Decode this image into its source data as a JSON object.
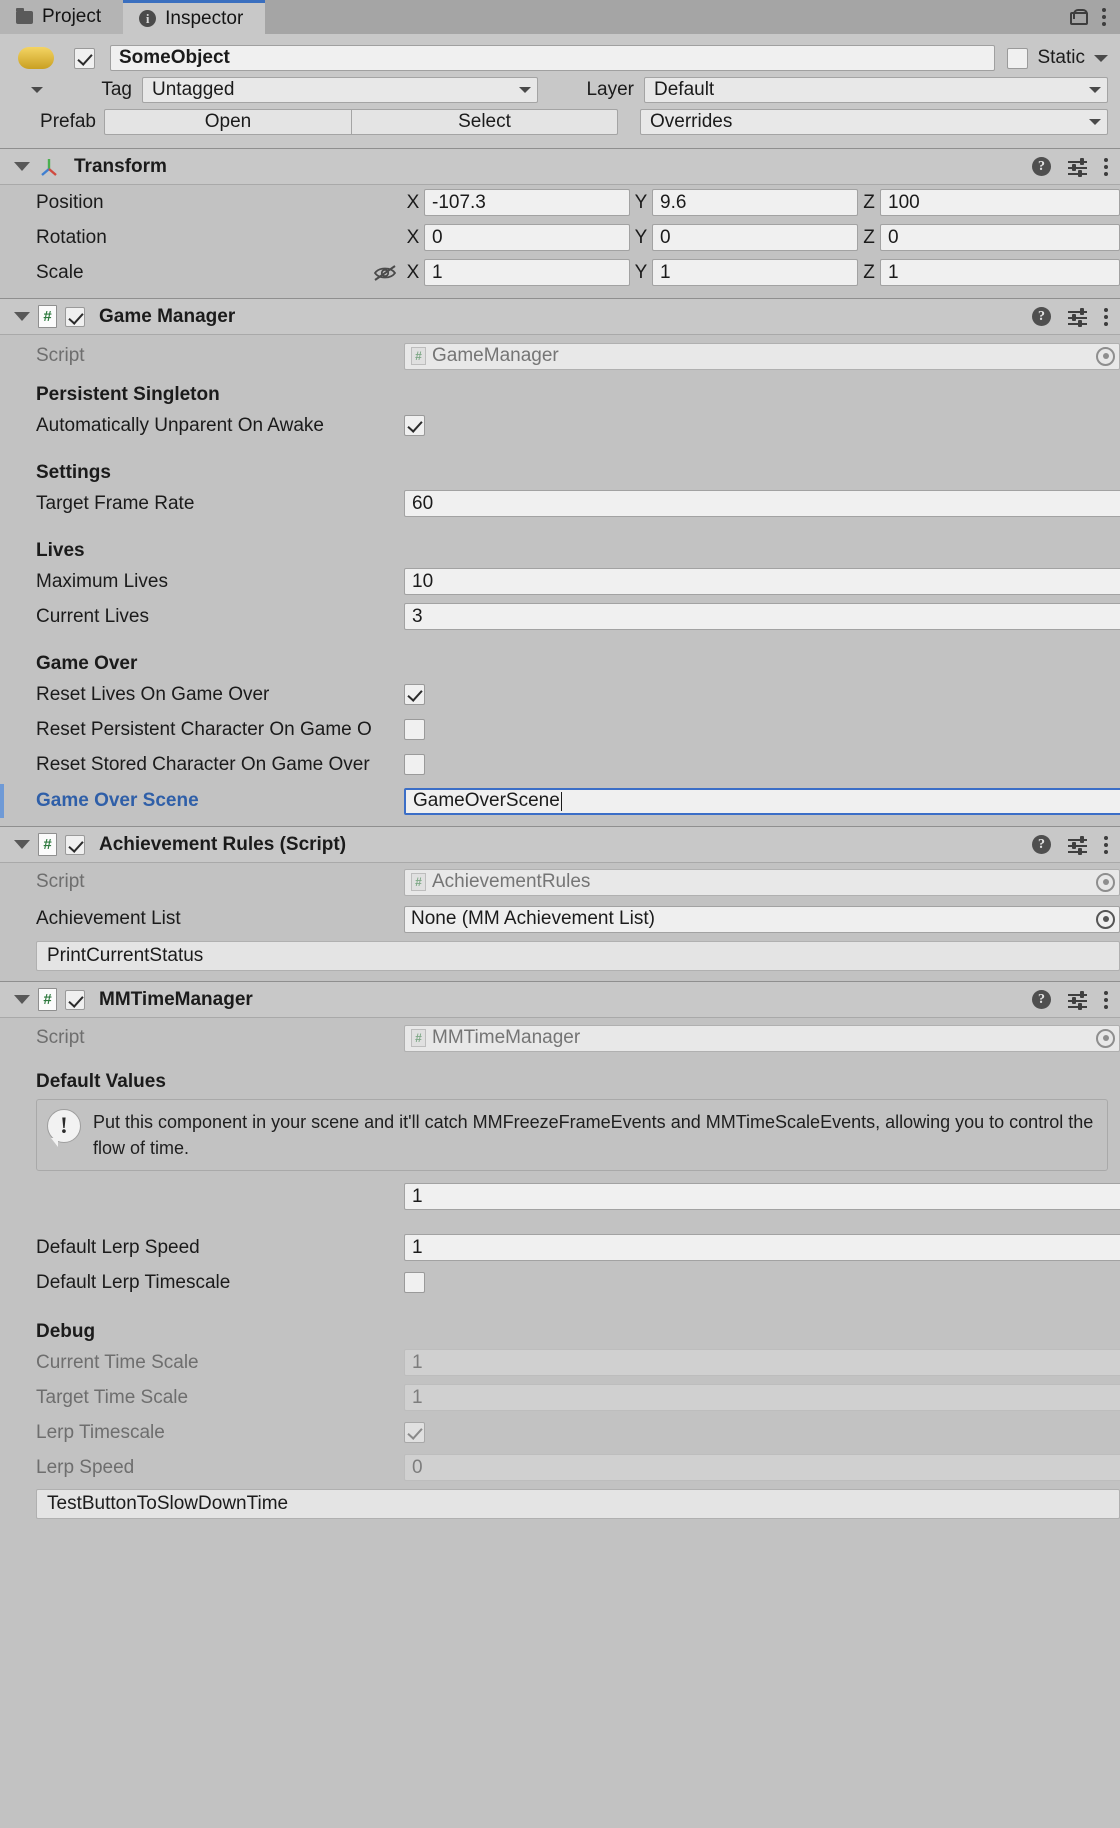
{
  "window": {
    "tabs": [
      {
        "label": "Project",
        "icon": "folder-icon",
        "active": false
      },
      {
        "label": "Inspector",
        "icon": "info-icon",
        "active": true
      }
    ],
    "lock_icon": "lock-icon",
    "menu_icon": "kebab-menu-icon"
  },
  "object_header": {
    "enabled": true,
    "name": "SomeObject",
    "static_label": "Static",
    "static_checked": false,
    "tag_label": "Tag",
    "tag_value": "Untagged",
    "layer_label": "Layer",
    "layer_value": "Default",
    "prefab_label": "Prefab",
    "open_label": "Open",
    "select_label": "Select",
    "overrides_label": "Overrides"
  },
  "transform": {
    "title": "Transform",
    "icon": "transform-axis-icon",
    "rows": [
      {
        "label": "Position",
        "x": "-107.3",
        "y": "9.6",
        "z": "100"
      },
      {
        "label": "Rotation",
        "x": "0",
        "y": "0",
        "z": "0"
      },
      {
        "label": "Scale",
        "x": "1",
        "y": "1",
        "z": "1",
        "constrain_icon": "eye-off-icon"
      }
    ],
    "axes": [
      "X",
      "Y",
      "Z"
    ]
  },
  "game_manager": {
    "title": "Game Manager",
    "enabled": true,
    "script_label": "Script",
    "script_value": "GameManager",
    "sections": [
      {
        "heading": "Persistent Singleton",
        "fields": [
          {
            "type": "checkbox",
            "label": "Automatically Unparent On Awake",
            "value": true
          }
        ]
      },
      {
        "heading": "Settings",
        "fields": [
          {
            "type": "text",
            "label": "Target Frame Rate",
            "value": "60"
          }
        ]
      },
      {
        "heading": "Lives",
        "fields": [
          {
            "type": "text",
            "label": "Maximum Lives",
            "value": "10"
          },
          {
            "type": "text",
            "label": "Current Lives",
            "value": "3"
          }
        ]
      },
      {
        "heading": "Game Over",
        "fields": [
          {
            "type": "checkbox",
            "label": "Reset Lives On Game Over",
            "value": true
          },
          {
            "type": "checkbox",
            "label": "Reset Persistent Character On Game O",
            "value": false
          },
          {
            "type": "checkbox",
            "label": "Reset Stored Character On Game Over",
            "value": false
          },
          {
            "type": "text-focused",
            "label": "Game Over Scene",
            "value": "GameOverScene",
            "highlight": true
          }
        ]
      }
    ]
  },
  "achievement_rules": {
    "title": "Achievement Rules (Script)",
    "enabled": true,
    "script_label": "Script",
    "script_value": "AchievementRules",
    "achievement_list_label": "Achievement List",
    "achievement_list_value": "None (MM Achievement List)",
    "button_label": "PrintCurrentStatus"
  },
  "mm_time_manager": {
    "title": "MMTimeManager",
    "enabled": true,
    "script_label": "Script",
    "script_value": "MMTimeManager",
    "default_values_heading": "Default Values",
    "info_text": "Put this component in your scene and it'll catch MMFreezeFrameEvents and MMTimeScaleEvents, allowing you to control the flow of time.",
    "info_icon": "exclamation-bubble-icon",
    "fields": [
      {
        "type": "text",
        "label": "",
        "value": "1"
      },
      {
        "type": "text",
        "label": "Default Lerp Speed",
        "value": "1"
      },
      {
        "type": "checkbox",
        "label": "Default Lerp Timescale",
        "value": false
      }
    ],
    "debug_heading": "Debug",
    "debug_fields": [
      {
        "type": "text",
        "label": "Current Time Scale",
        "value": "1",
        "disabled": true
      },
      {
        "type": "text",
        "label": "Target Time Scale",
        "value": "1",
        "disabled": true
      },
      {
        "type": "checkbox",
        "label": "Lerp Timescale",
        "value": true,
        "disabled": true
      },
      {
        "type": "text",
        "label": "Lerp Speed",
        "value": "0",
        "disabled": true
      }
    ],
    "button_label": "TestButtonToSlowDownTime"
  },
  "colors": {
    "panel": "#c2c2c2",
    "header": "#c8c8c8",
    "field": "#f0f0f0",
    "accent_blue": "#2f5fa8",
    "focus_border": "#3b6ec7",
    "tab_active_top": "#3a6fbf"
  }
}
